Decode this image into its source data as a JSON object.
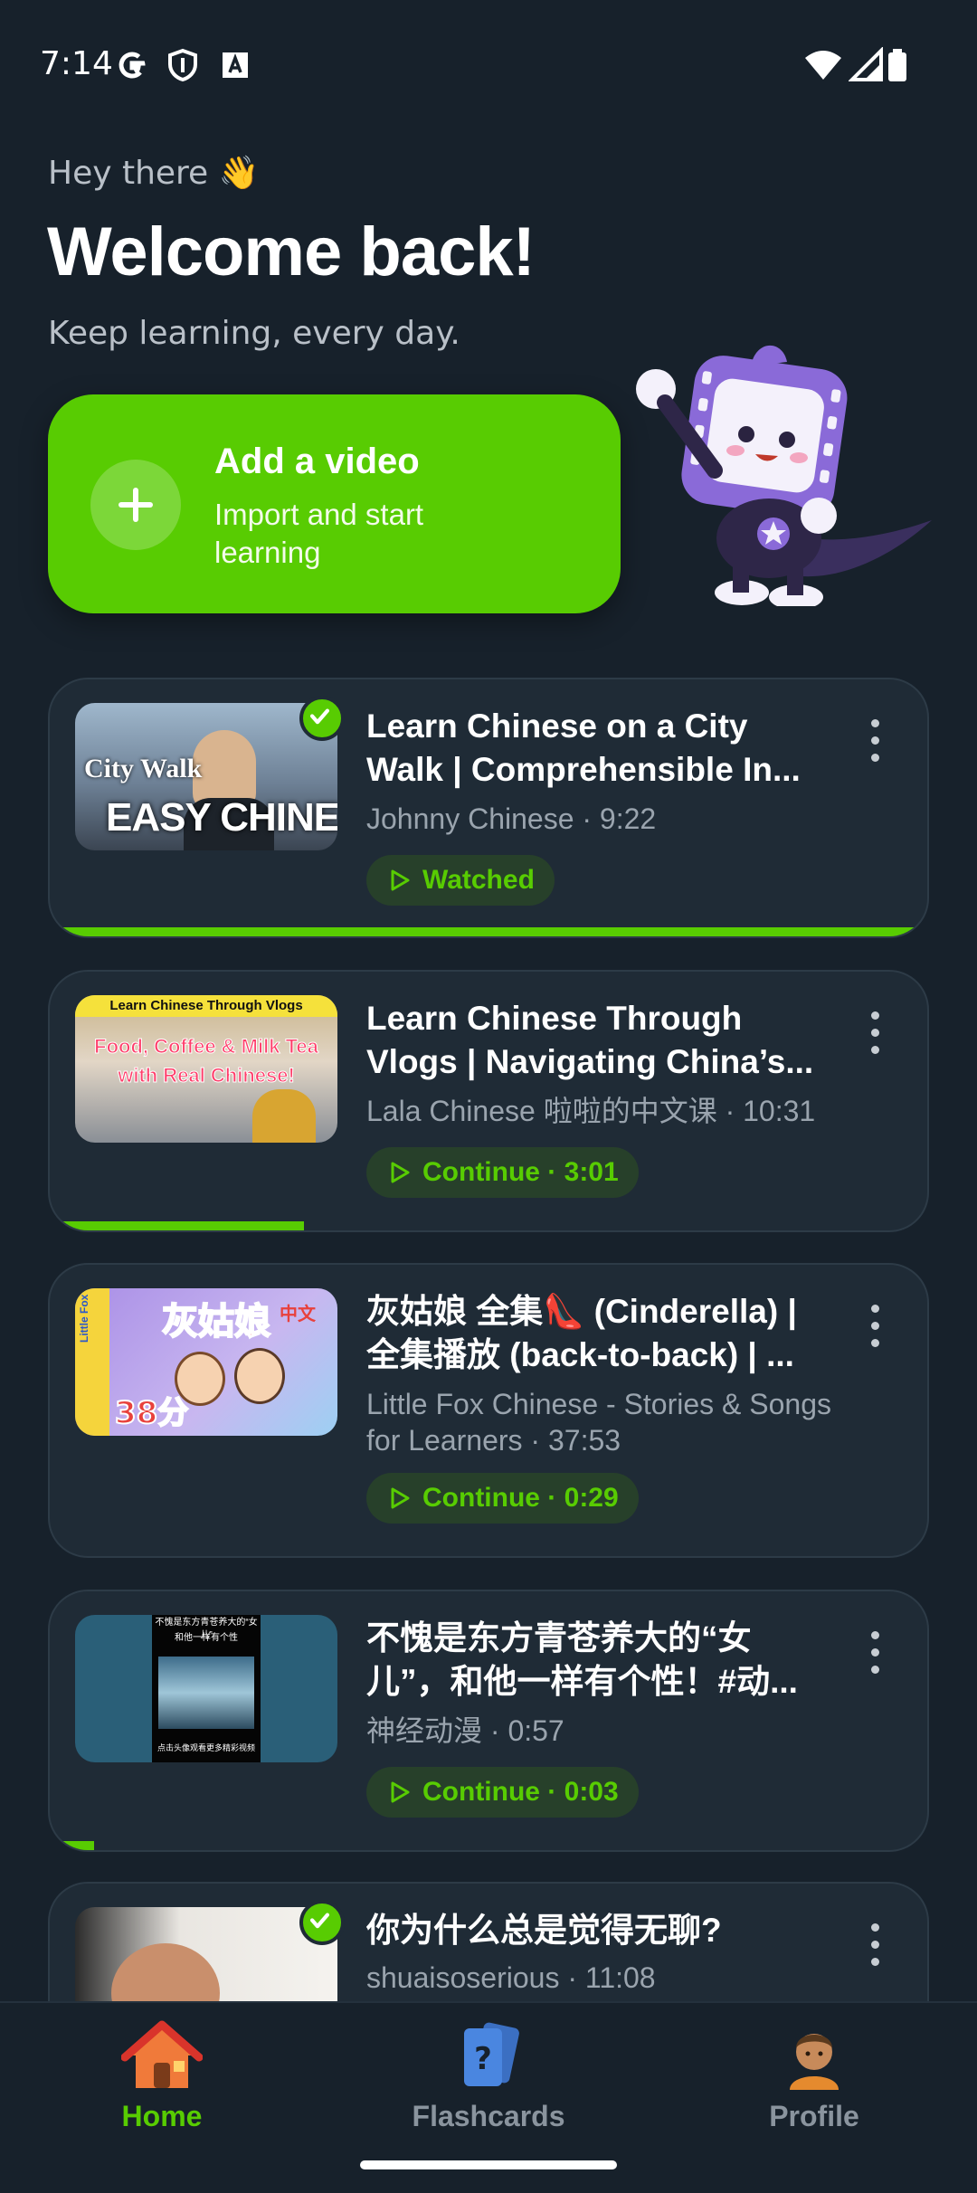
{
  "status_bar": {
    "time": "7:14"
  },
  "hero": {
    "greeting": "Hey there 👋",
    "title": "Welcome back!",
    "subtitle": "Keep learning, every day."
  },
  "add_video": {
    "title": "Add a video",
    "subtitle": "Import and start learning"
  },
  "videos": [
    {
      "title": "Learn Chinese on a City Walk | Comprehensible In...",
      "meta": "Johnny Chinese · 9:22",
      "action": "Watched",
      "watched": true,
      "progress": 1.0,
      "thumb": {
        "line1": "City Walk",
        "line2": "EASY CHINESE"
      }
    },
    {
      "title": "Learn Chinese Through Vlogs | Navigating China’s...",
      "meta": "Lala Chinese 啦啦的中文课 · 10:31",
      "action": "Continue · 3:01",
      "watched": false,
      "progress": 0.29,
      "thumb": {
        "line1": "Learn Chinese Through Vlogs",
        "line2": "Food, Coffee & Milk Tea",
        "line3": "with Real Chinese!"
      }
    },
    {
      "title": "灰姑娘 全集👠 (Cinderella) | 全集播放 (back-to-back) | ...",
      "meta": "Little Fox Chinese - Stories & Songs for Learners · 37:53",
      "action": "Continue · 0:29",
      "watched": false,
      "progress": 0.0,
      "thumb": {
        "line1": "灰姑娘",
        "line2": "中文",
        "line3": "38分",
        "line4": "Little Fox"
      }
    },
    {
      "title": "不愧是东方青苍养大的“女儿”，和他一样有个性！#动...",
      "meta": "神经动漫 · 0:57",
      "action": "Continue · 0:03",
      "watched": false,
      "progress": 0.05,
      "thumb": {
        "line1": "不愧是东方青苍养大的“女儿”",
        "line2": "和他一样有个性",
        "line3": "点击头像观看更多精彩视频"
      }
    },
    {
      "title": "你为什么总是觉得无聊?",
      "meta": "shuaisoserious · 11:08",
      "watched": true
    }
  ],
  "nav": {
    "home": "Home",
    "flashcards": "Flashcards",
    "profile": "Profile"
  },
  "colors": {
    "accent": "#58cc02",
    "background": "#17212b",
    "card": "#1f2b36"
  }
}
